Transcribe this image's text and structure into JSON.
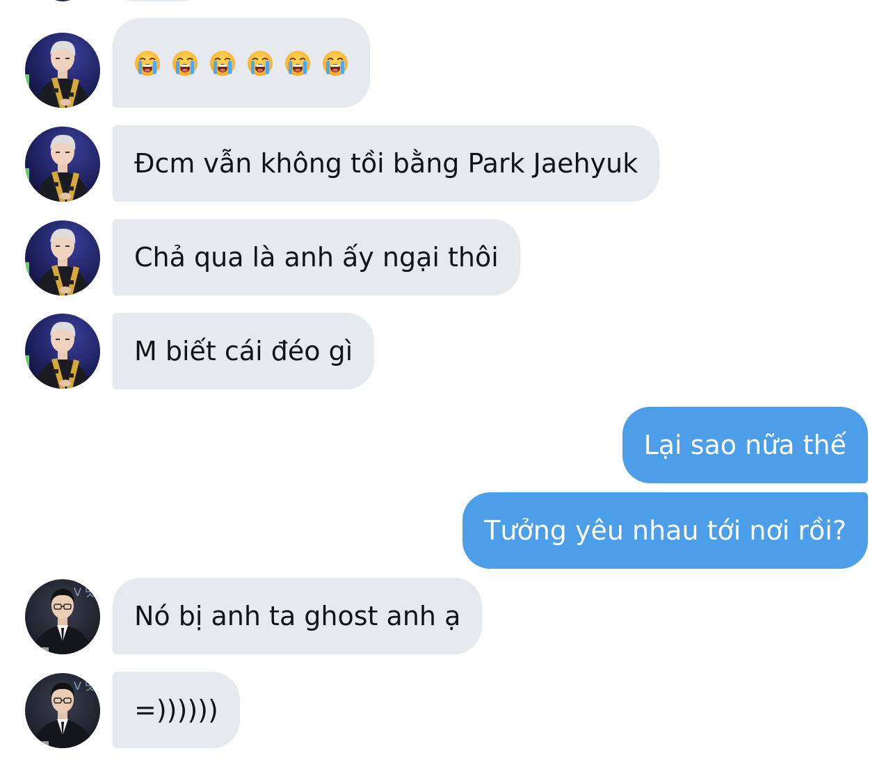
{
  "colors": {
    "incoming_bubble": "#e6eaee",
    "outgoing_bubble": "#4d9ee8",
    "incoming_text": "#111417",
    "outgoing_text": "#ffffff"
  },
  "messages": [
    {
      "direction": "in",
      "sender": "player-a",
      "emojis": [
        "loudly-crying-face",
        "loudly-crying-face",
        "loudly-crying-face",
        "loudly-crying-face",
        "loudly-crying-face",
        "loudly-crying-face"
      ]
    },
    {
      "direction": "in",
      "sender": "player-a",
      "text": "Đcm vẫn không tồi bằng Park Jaehyuk"
    },
    {
      "direction": "in",
      "sender": "player-a",
      "text": "Chả qua là anh ấy ngại thôi"
    },
    {
      "direction": "in",
      "sender": "player-a",
      "text": "M biết cái đéo gì"
    },
    {
      "direction": "out",
      "text": "Lại sao nữa thế"
    },
    {
      "direction": "out",
      "text": "Tưởng yêu nhau tới nơi rồi?"
    },
    {
      "direction": "in",
      "sender": "player-b",
      "text": "Nó bị anh ta ghost anh ạ"
    },
    {
      "direction": "in",
      "sender": "player-b",
      "text": "=))))))"
    }
  ]
}
